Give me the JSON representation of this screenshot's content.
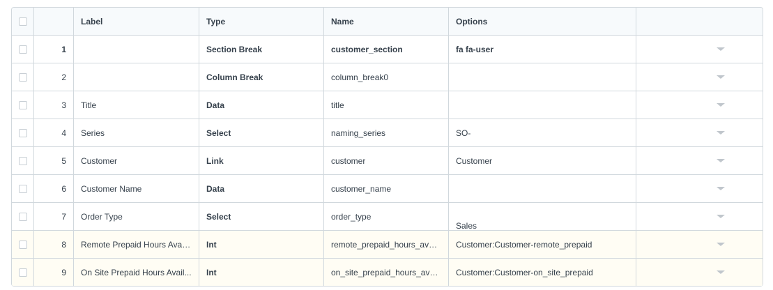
{
  "columns": {
    "label": "Label",
    "type": "Type",
    "name": "Name",
    "options": "Options"
  },
  "rows": [
    {
      "idx": "1",
      "label": "",
      "type": "Section Break",
      "name": "customer_section",
      "options": "fa fa-user",
      "bold_index": true,
      "bold_name": true,
      "bold_options": true,
      "highlight": false
    },
    {
      "idx": "2",
      "label": "",
      "type": "Column Break",
      "name": "column_break0",
      "options": "",
      "bold_index": false,
      "bold_name": false,
      "bold_options": false,
      "highlight": false
    },
    {
      "idx": "3",
      "label": "Title",
      "type": "Data",
      "name": "title",
      "options": "",
      "bold_index": false,
      "bold_name": false,
      "bold_options": false,
      "highlight": false
    },
    {
      "idx": "4",
      "label": "Series",
      "type": "Select",
      "name": "naming_series",
      "options": "SO-",
      "bold_index": false,
      "bold_name": false,
      "bold_options": false,
      "highlight": false
    },
    {
      "idx": "5",
      "label": "Customer",
      "type": "Link",
      "name": "customer",
      "options": "Customer",
      "bold_index": false,
      "bold_name": false,
      "bold_options": false,
      "highlight": false
    },
    {
      "idx": "6",
      "label": "Customer Name",
      "type": "Data",
      "name": "customer_name",
      "options": "",
      "bold_index": false,
      "bold_name": false,
      "bold_options": false,
      "highlight": false
    },
    {
      "idx": "7",
      "label": "Order Type",
      "type": "Select",
      "name": "order_type",
      "options": "Sales",
      "bold_index": false,
      "bold_name": false,
      "bold_options": false,
      "highlight": false,
      "options_low": true
    },
    {
      "idx": "8",
      "label": "Remote Prepaid Hours Avail...",
      "type": "Int",
      "name": "remote_prepaid_hours_avail...",
      "options": "Customer:Customer-remote_prepaid",
      "bold_index": false,
      "bold_name": false,
      "bold_options": false,
      "highlight": true
    },
    {
      "idx": "9",
      "label": "On Site Prepaid Hours Avail...",
      "type": "Int",
      "name": "on_site_prepaid_hours_avail...",
      "options": "Customer:Customer-on_site_prepaid",
      "bold_index": false,
      "bold_name": false,
      "bold_options": false,
      "highlight": true
    }
  ]
}
